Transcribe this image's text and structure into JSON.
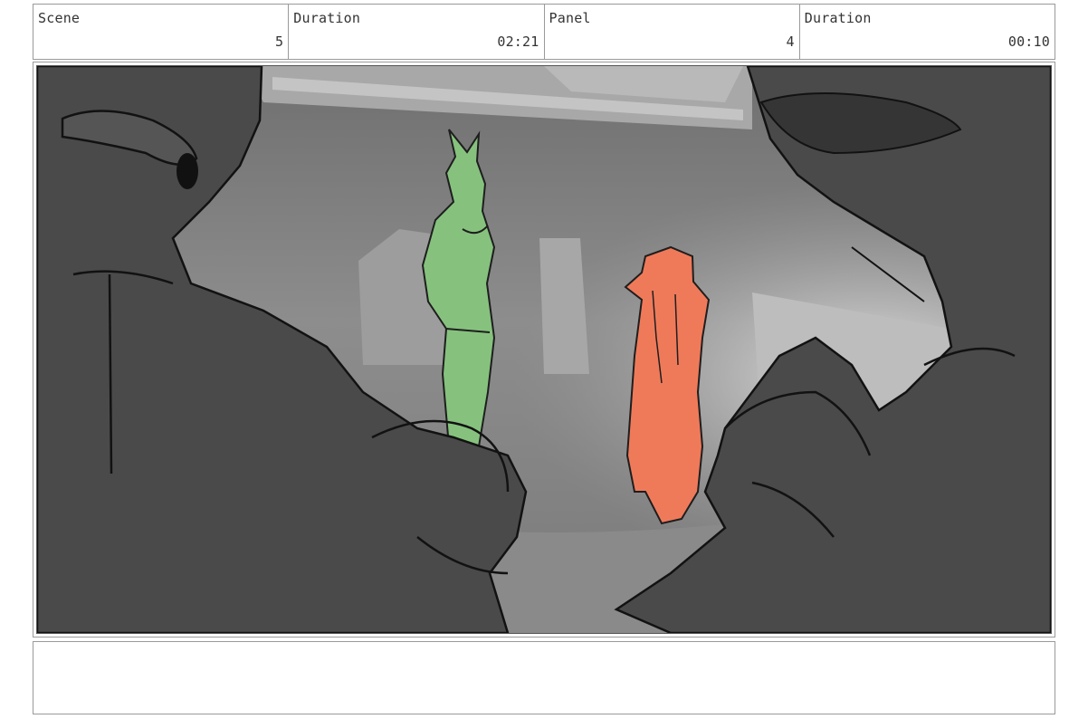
{
  "header": {
    "scene_label": "Scene",
    "scene_value": "5",
    "scene_duration_label": "Duration",
    "scene_duration_value": "02:21",
    "panel_label": "Panel",
    "panel_value": "4",
    "panel_duration_label": "Duration",
    "panel_duration_value": "00:10"
  },
  "notes": {
    "text": ""
  },
  "colors": {
    "foreground_silhouette": "#4a4a4a",
    "green_character": "#86c27e",
    "red_character": "#ef7a5a",
    "background_grey": "#8e8e8e",
    "frame_border": "#9a9a9a"
  }
}
